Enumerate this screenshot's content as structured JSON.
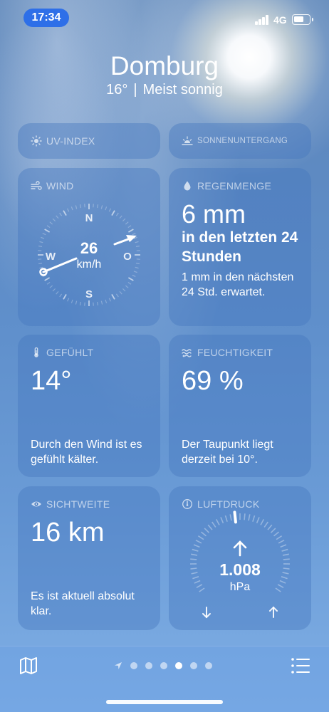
{
  "status_bar": {
    "time": "17:34",
    "network": "4G"
  },
  "header": {
    "location": "Domburg",
    "temperature": "16°",
    "separator": "|",
    "condition": "Meist sonnig"
  },
  "cards": {
    "uv": {
      "title": "UV-INDEX",
      "icon": "sun-icon"
    },
    "sunset": {
      "title": "SONNENUNTERGANG",
      "icon": "sunset-icon"
    },
    "wind": {
      "title": "WIND",
      "icon": "wind-icon",
      "speed": "26",
      "unit": "km/h",
      "directions": {
        "n": "N",
        "e": "O",
        "s": "S",
        "w": "W"
      }
    },
    "rain": {
      "title": "REGENMENGE",
      "icon": "raindrop-icon",
      "value": "6 mm",
      "subtitle": "in den letzten 24 Stunden",
      "note": "1 mm in den nächsten 24 Std. erwartet."
    },
    "feels_like": {
      "title": "GEFÜHLT",
      "icon": "thermometer-icon",
      "value": "14°",
      "desc": "Durch den Wind ist es gefühlt kälter."
    },
    "humidity": {
      "title": "FEUCHTIGKEIT",
      "icon": "humidity-icon",
      "value": "69 %",
      "desc": "Der Taupunkt liegt derzeit bei 10°."
    },
    "visibility": {
      "title": "SICHTWEITE",
      "icon": "eye-icon",
      "value": "16 km",
      "desc": "Es ist aktuell absolut klar."
    },
    "pressure": {
      "title": "LUFTDRUCK",
      "icon": "gauge-icon",
      "value": "1.008",
      "unit": "hPa"
    }
  },
  "bottom_bar": {
    "page_count": 6,
    "active_page": 4
  },
  "colors": {
    "time_pill": "#2e6fe8",
    "card_bg": "rgba(70,120,190,0.42)"
  }
}
